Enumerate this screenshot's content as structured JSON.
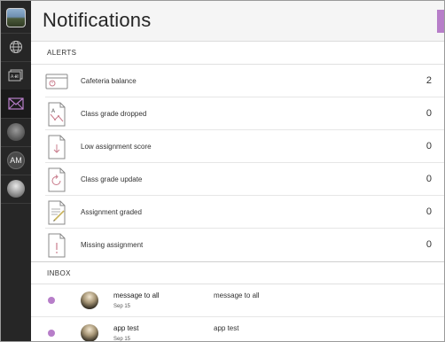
{
  "page": {
    "title": "Notifications"
  },
  "rail": {
    "items": [
      {
        "icon": "institution-logo"
      },
      {
        "icon": "globe-icon"
      },
      {
        "icon": "grades-card-icon"
      },
      {
        "icon": "mail-icon",
        "active": true
      },
      {
        "icon": "user-avatar"
      },
      {
        "icon": "user-avatar",
        "initials": "AM"
      },
      {
        "icon": "user-avatar"
      }
    ],
    "initials": "AM"
  },
  "alerts": {
    "header": "ALERTS",
    "items": [
      {
        "label": "Cafeteria balance",
        "count": "2",
        "icon": "cafeteria-card-icon"
      },
      {
        "label": "Class grade dropped",
        "count": "0",
        "icon": "grade-dropped-icon"
      },
      {
        "label": "Low assignment score",
        "count": "0",
        "icon": "low-score-icon"
      },
      {
        "label": "Class grade update",
        "count": "0",
        "icon": "grade-update-icon"
      },
      {
        "label": "Assignment graded",
        "count": "0",
        "icon": "assignment-graded-icon"
      },
      {
        "label": "Missing assignment",
        "count": "0",
        "icon": "missing-assignment-icon"
      }
    ]
  },
  "inbox": {
    "header": "INBOX",
    "messages": [
      {
        "subject": "message to all",
        "date": "Sep 15",
        "preview": "message to all",
        "unread": true
      },
      {
        "subject": "app test",
        "date": "Sep 15",
        "preview": "app test",
        "unread": true
      }
    ]
  },
  "colors": {
    "accent": "#b77ec9",
    "rail": "#262626",
    "icon_pink": "#c97c8c"
  }
}
